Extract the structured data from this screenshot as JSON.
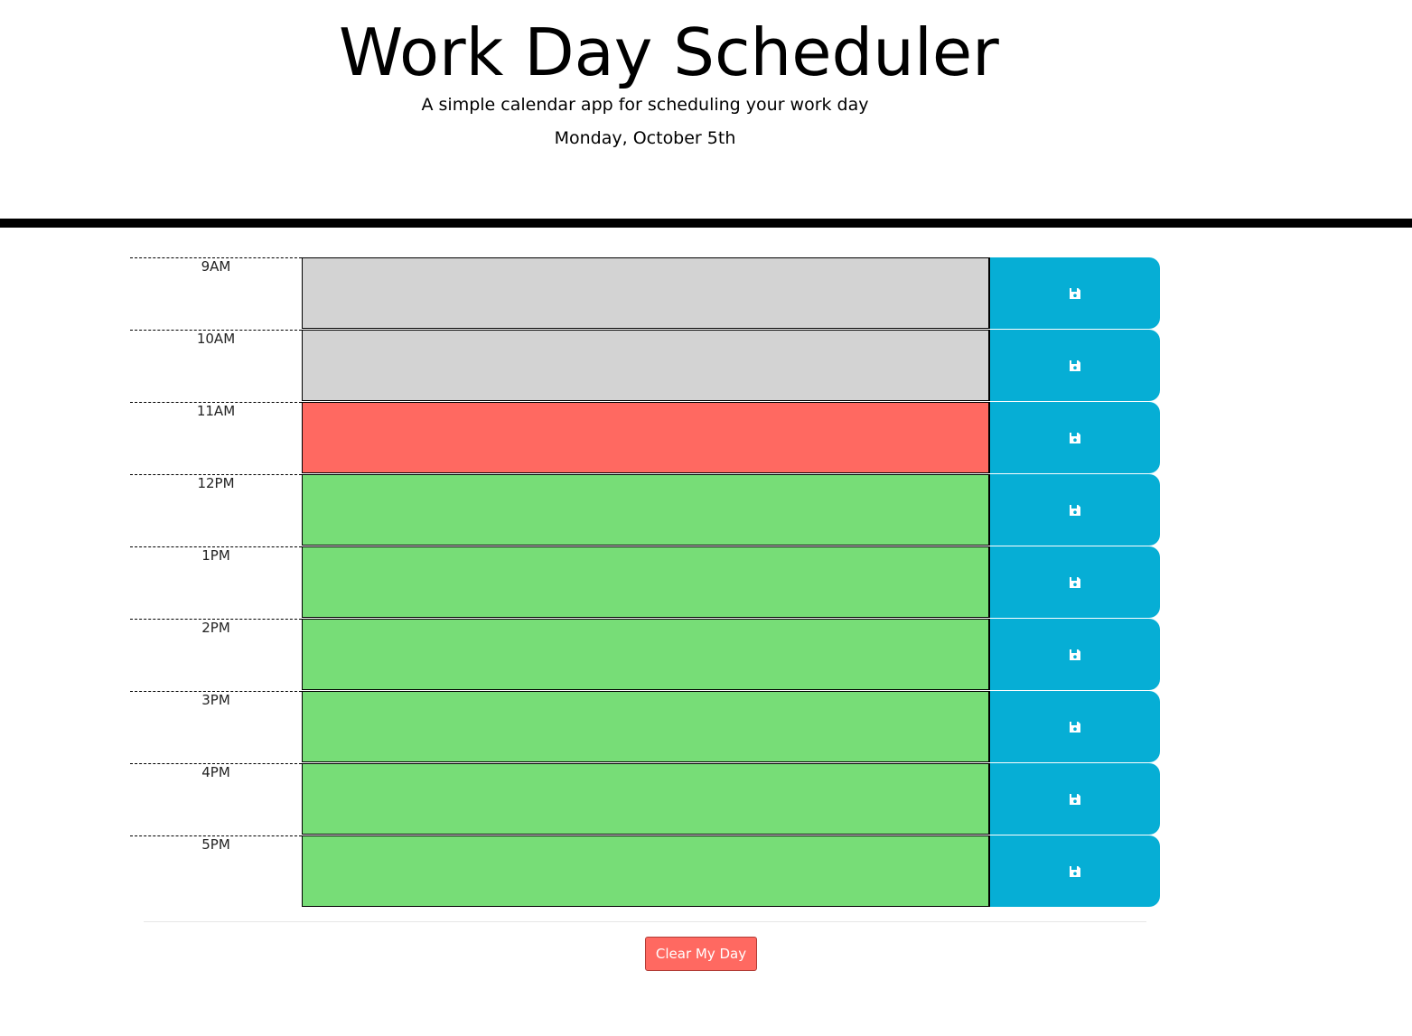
{
  "header": {
    "title": "Work Day Scheduler",
    "subtitle": "A simple calendar app for scheduling your work day",
    "current_day": "Monday, October 5th"
  },
  "time_blocks": [
    {
      "hour": "9AM",
      "text": "",
      "status": "past"
    },
    {
      "hour": "10AM",
      "text": "",
      "status": "past"
    },
    {
      "hour": "11AM",
      "text": "",
      "status": "present"
    },
    {
      "hour": "12PM",
      "text": "",
      "status": "future"
    },
    {
      "hour": "1PM",
      "text": "",
      "status": "future"
    },
    {
      "hour": "2PM",
      "text": "",
      "status": "future"
    },
    {
      "hour": "3PM",
      "text": "",
      "status": "future"
    },
    {
      "hour": "4PM",
      "text": "",
      "status": "future"
    },
    {
      "hour": "5PM",
      "text": "",
      "status": "future"
    }
  ],
  "save_icon": "floppy-disk-icon",
  "clear_button": {
    "label": "Clear My Day"
  },
  "colors": {
    "past": "#d3d3d3",
    "present": "#ff6961",
    "future": "#77dd77",
    "save": "#06aed5"
  }
}
